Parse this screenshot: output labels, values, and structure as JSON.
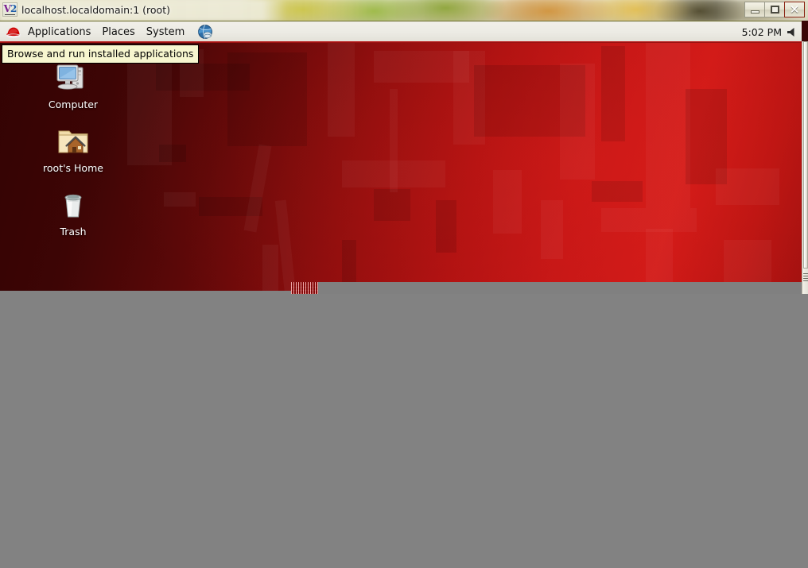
{
  "window": {
    "icon_name": "vnc-viewer-icon",
    "icon_text_v": "V",
    "icon_text_2": "2",
    "title": "localhost.localdomain:1 (root)",
    "buttons": {
      "minimize_label": "–",
      "maximize_label": "□",
      "close_label": "✕"
    }
  },
  "panel": {
    "logo_name": "redhat-logo",
    "menus": [
      {
        "label": "Applications",
        "name": "menu-applications"
      },
      {
        "label": "Places",
        "name": "menu-places"
      },
      {
        "label": "System",
        "name": "menu-system"
      }
    ],
    "launcher_name": "web-browser-launcher-icon",
    "clock": "5:02 PM",
    "volume_icon_name": "volume-speaker-icon"
  },
  "tooltip": {
    "text": "Browse and run installed applications"
  },
  "desktop": {
    "icons": [
      {
        "label": "Computer",
        "name": "desktop-icon-computer"
      },
      {
        "label": "root's Home",
        "name": "desktop-icon-root-home"
      },
      {
        "label": "Trash",
        "name": "desktop-icon-trash"
      }
    ]
  },
  "colors": {
    "wallpaper_red": "#c21616",
    "wallpaper_dark": "#330303",
    "panel_bg": "#ecebe4",
    "tooltip_bg": "#f7f6cf",
    "close_button": "#c03018",
    "grey_area": "#828282"
  }
}
